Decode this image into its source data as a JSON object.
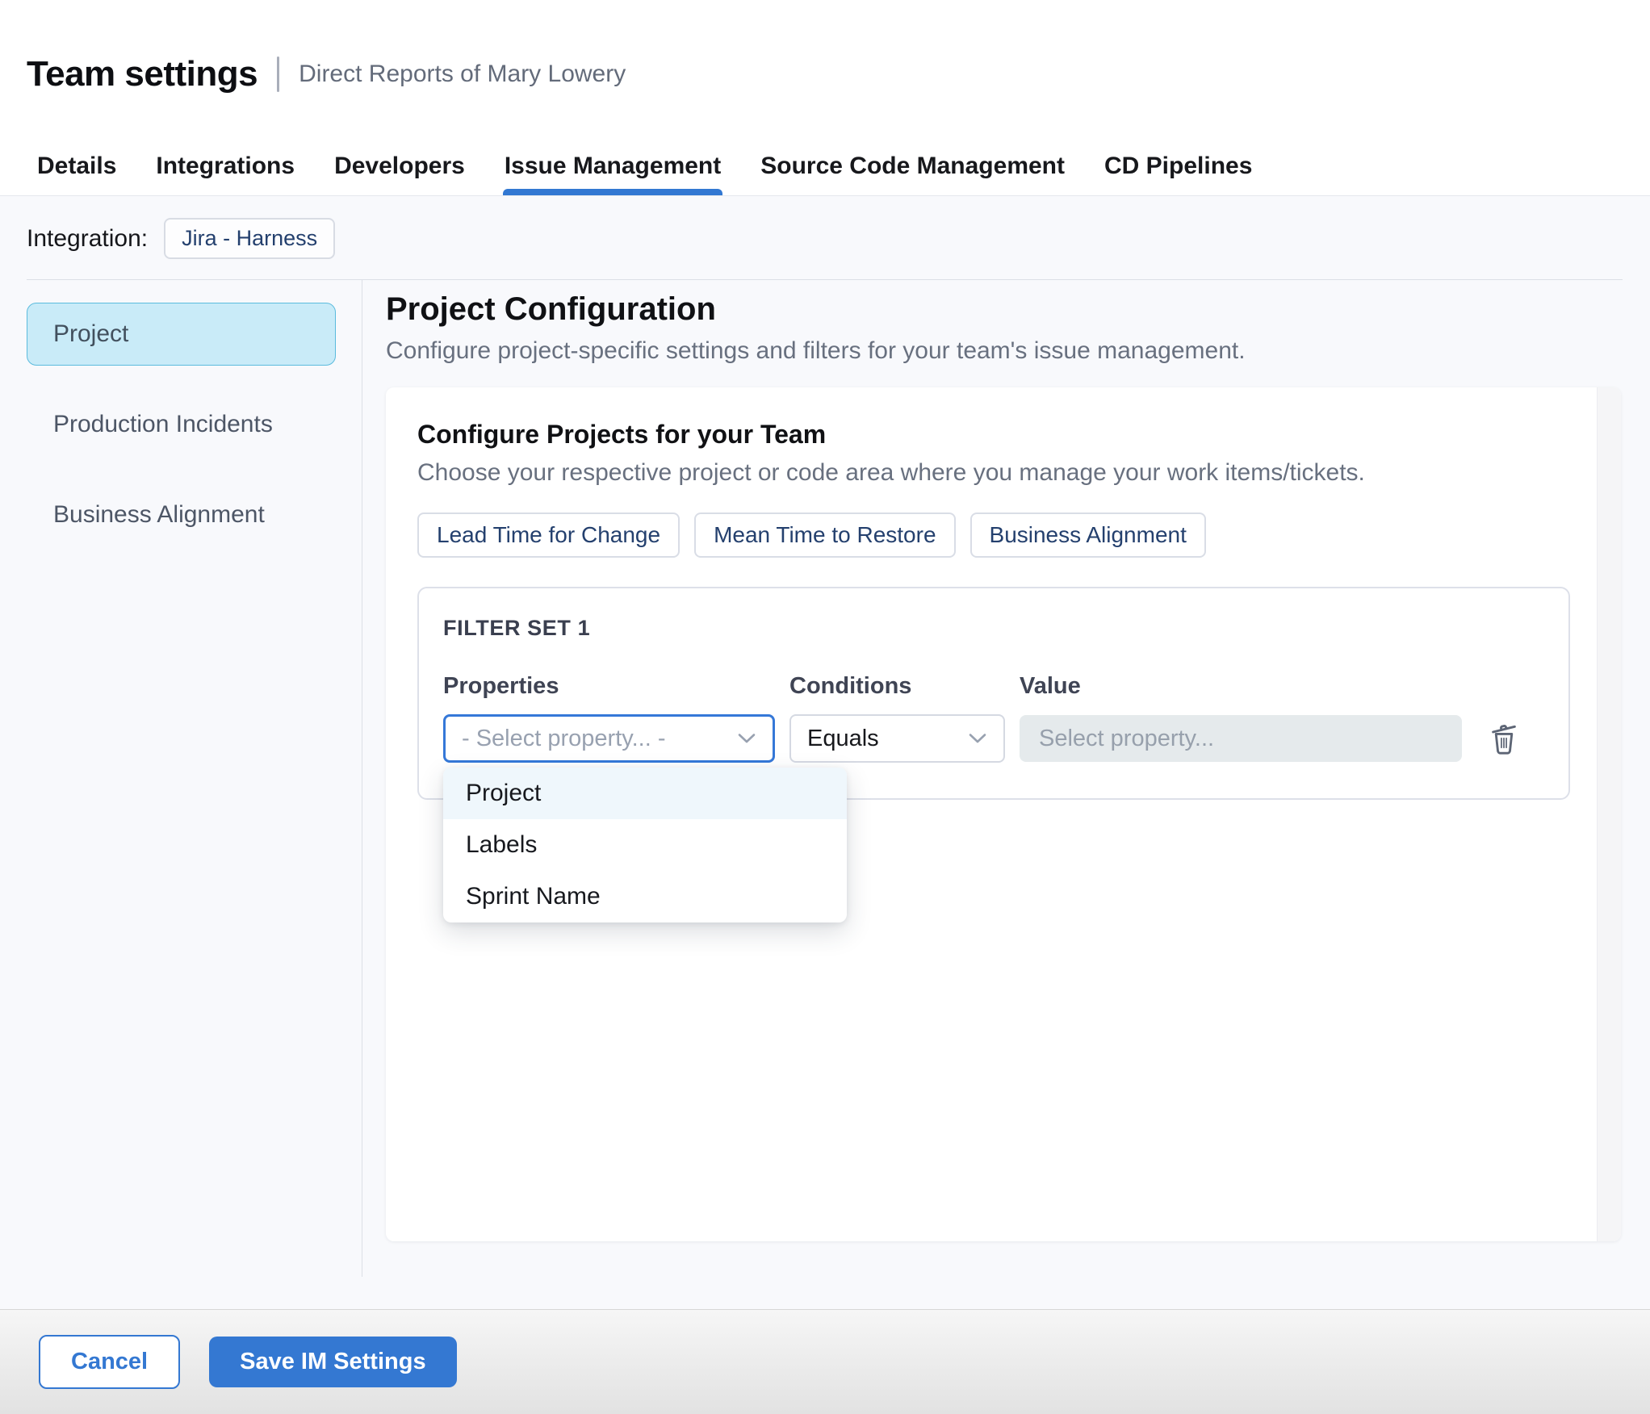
{
  "header": {
    "title": "Team settings",
    "subtitle": "Direct Reports of Mary Lowery"
  },
  "tabs": [
    {
      "label": "Details",
      "active": false
    },
    {
      "label": "Integrations",
      "active": false
    },
    {
      "label": "Developers",
      "active": false
    },
    {
      "label": "Issue Management",
      "active": true
    },
    {
      "label": "Source Code Management",
      "active": false
    },
    {
      "label": "CD Pipelines",
      "active": false
    }
  ],
  "integration": {
    "label": "Integration:",
    "value": "Jira - Harness"
  },
  "sidebar": {
    "items": [
      {
        "label": "Project",
        "selected": true
      },
      {
        "label": "Production Incidents",
        "selected": false
      },
      {
        "label": "Business Alignment",
        "selected": false
      }
    ]
  },
  "main": {
    "title": "Project Configuration",
    "subtitle": "Configure project-specific settings and filters for your team's issue management.",
    "card": {
      "title": "Configure Projects for your Team",
      "subtitle": "Choose your respective project or code area where you manage your work items/tickets.",
      "chips": [
        "Lead Time for Change",
        "Mean Time to Restore",
        "Business Alignment"
      ],
      "filter_set": {
        "title": "FILTER SET 1",
        "columns": [
          "Properties",
          "Conditions",
          "Value"
        ],
        "row": {
          "property_placeholder": "- Select property... -",
          "condition_value": "Equals",
          "value_placeholder": "Select property..."
        },
        "dropdown_options": [
          {
            "label": "Project",
            "highlighted": true
          },
          {
            "label": "Labels",
            "highlighted": false
          },
          {
            "label": "Sprint Name",
            "highlighted": false
          }
        ]
      }
    }
  },
  "footer": {
    "cancel_label": "Cancel",
    "save_label": "Save IM Settings"
  },
  "icons": [
    "chevron-down-icon",
    "trash-icon"
  ],
  "colors": {
    "accent_blue": "#3478d2",
    "focus_border_blue": "#3578d8",
    "tab_underline": "#3278d2",
    "sidebar_selected_bg": "#c9ebf8",
    "sidebar_selected_border": "#5bbbdd",
    "chip_text_navy": "#24406e",
    "dropdown_highlight_bg": "#eff7fc",
    "value_input_bg": "#e5eaec",
    "page_bg": "#f8f9fc"
  }
}
